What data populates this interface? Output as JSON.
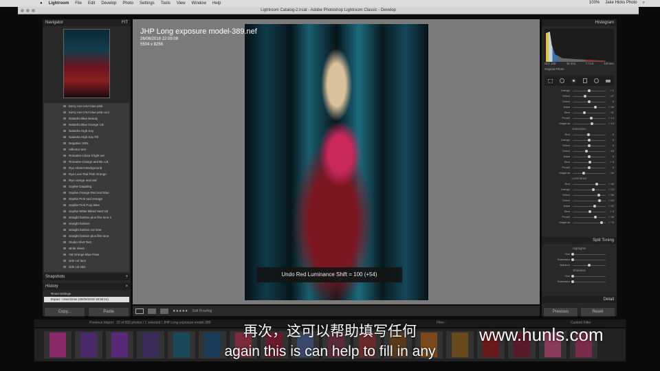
{
  "menubar": {
    "app": "Lightroom",
    "items": [
      "File",
      "Edit",
      "Develop",
      "Photo",
      "Settings",
      "Tools",
      "View",
      "Window",
      "Help"
    ],
    "battery": "100%",
    "user": "Jake Hicks Photo"
  },
  "window": {
    "title": "Lightroom Catalog-2.lrcat - Adobe Photoshop Lightroom Classic - Develop"
  },
  "left": {
    "navigator": "Navigator",
    "nav_zoom": "FIT",
    "presets": [
      "Kerry Ann USA blue pink",
      "Kerry Ann USA blue pink cool",
      "Natasha Blue Beauty",
      "Natasha Blue Orange CB",
      "Natasha High Key",
      "Natasha High Key Fill",
      "Negative 100L",
      "reflector test",
      "Romaine colour Il light set",
      "Romaine Orange and Blu LB",
      "Rye Absent Background",
      "Rye Love Teal Pink Orange",
      "Rye orange and teal",
      "Sophie Dappling",
      "Sophie Orange Red and Blue",
      "Sophie Pink and Orange",
      "Sophie Pink Purp Blue",
      "Sophie White Blend Hard LB",
      "straight fashion plus film tone 2",
      "straight fashion",
      "straight fashion col tone",
      "straight fashion plus film tone",
      "Studio Shot Test",
      "white sheet",
      "Yat Orange Blue Pass",
      "side col face",
      "side col skin"
    ],
    "snapshots": "Snapshots",
    "history": "History",
    "history_items": [
      "Reset Settings",
      "Export - Hard Drive (30/06/2018 18:50:11)"
    ],
    "copy": "Copy...",
    "paste": "Paste"
  },
  "center": {
    "filename": "JHP Long exposure model-389.nef",
    "date": "26/06/2018 22:09:08",
    "dims": "5504 x 8256",
    "toast": "Undo Red Luminance Shift = 100 (+54)",
    "stars": "★★★★★",
    "soft_proofing": "Soft Proofing"
  },
  "right": {
    "histogram": "Histogram",
    "iso": "ISO 100",
    "focal": "44 mm",
    "aperture": "f / 5.6",
    "shutter": "1/8 sec",
    "original": "Original Photo",
    "hue": [
      {
        "l": "Orange",
        "v": "+ 1"
      },
      {
        "l": "Yellow",
        "v": "- 27"
      },
      {
        "l": "Green",
        "v": "0"
      },
      {
        "l": "Aqua",
        "v": "+ 38"
      },
      {
        "l": "Blue",
        "v": "- 31"
      },
      {
        "l": "Purple",
        "v": "+ 14"
      },
      {
        "l": "Magenta",
        "v": "+ 15"
      }
    ],
    "saturation_label": "Saturation",
    "saturation": [
      {
        "l": "Red",
        "v": "- 5"
      },
      {
        "l": "Orange",
        "v": "0"
      },
      {
        "l": "Yellow",
        "v": "0"
      },
      {
        "l": "Green",
        "v": "- 16"
      },
      {
        "l": "Aqua",
        "v": "0"
      },
      {
        "l": "Blue",
        "v": "+ 5"
      },
      {
        "l": "Purple",
        "v": "0"
      },
      {
        "l": "Magenta",
        "v": "- 34"
      }
    ],
    "luminance_label": "Luminance",
    "luminance": [
      {
        "l": "Red",
        "v": "+ 46"
      },
      {
        "l": "Orange",
        "v": "+ 23"
      },
      {
        "l": "Yellow",
        "v": "+ 58"
      },
      {
        "l": "Green",
        "v": "+ 63"
      },
      {
        "l": "Aqua",
        "v": "+ 32"
      },
      {
        "l": "Blue",
        "v": "+ 3"
      },
      {
        "l": "Purple",
        "v": "+ 39"
      },
      {
        "l": "Magenta",
        "v": "+ 75"
      }
    ],
    "split_toning": "Split Toning",
    "highlights": "Highlights",
    "hue_l": "Hue",
    "sat_l": "Saturation",
    "balance": "Balance",
    "shadows": "Shadows",
    "detail": "Detail",
    "previous": "Previous",
    "reset": "Reset"
  },
  "filmstrip": {
    "source": "Previous Import",
    "count": "33 of 832 photos / 1 selected / JHP Long exposure model-389",
    "filter": "Filter :",
    "custom_filter": "Custom Filter"
  },
  "subtitles": {
    "cn": "再次，这可以帮助填写任何",
    "en": "again this is can help to fill in any"
  },
  "watermark": "www.hunls.com"
}
